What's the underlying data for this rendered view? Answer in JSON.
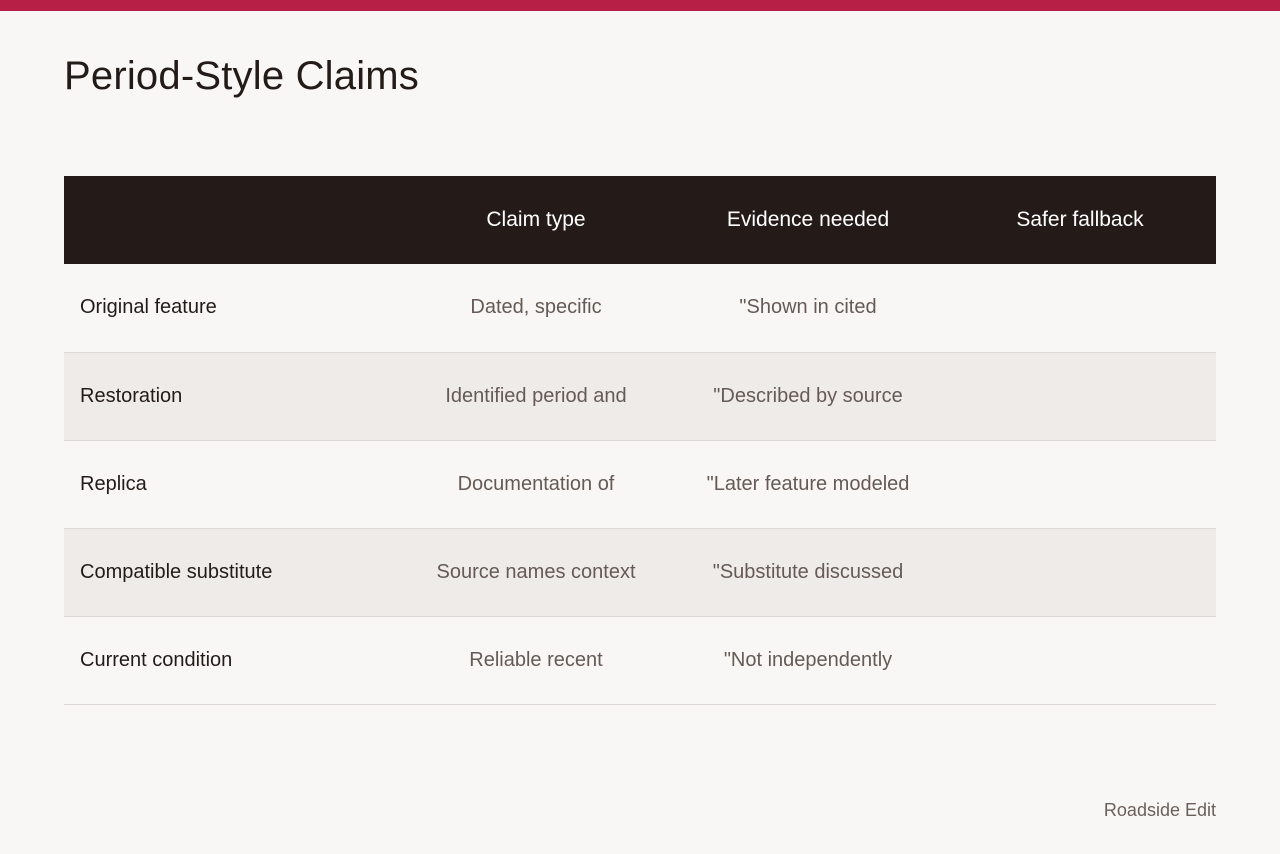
{
  "title": "Period-Style Claims",
  "colors": {
    "accent": "#b81f47",
    "header_bg": "#241b18",
    "page_bg": "#f8f7f5",
    "alt_row_bg": "#efebe9"
  },
  "table": {
    "headers": [
      "",
      "Claim type",
      "Evidence needed",
      "Safer fallback"
    ],
    "rows": [
      {
        "label": "Original feature",
        "claim_type": "Dated, specific",
        "evidence": "\"Shown in cited",
        "fallback": ""
      },
      {
        "label": "Restoration",
        "claim_type": "Identified period and",
        "evidence": "\"Described by source",
        "fallback": ""
      },
      {
        "label": "Replica",
        "claim_type": "Documentation of",
        "evidence": "\"Later feature modeled",
        "fallback": ""
      },
      {
        "label": "Compatible substitute",
        "claim_type": "Source names context",
        "evidence": "\"Substitute discussed",
        "fallback": ""
      },
      {
        "label": "Current condition",
        "claim_type": "Reliable recent",
        "evidence": "\"Not independently",
        "fallback": ""
      }
    ]
  },
  "footer": "Roadside Edit"
}
